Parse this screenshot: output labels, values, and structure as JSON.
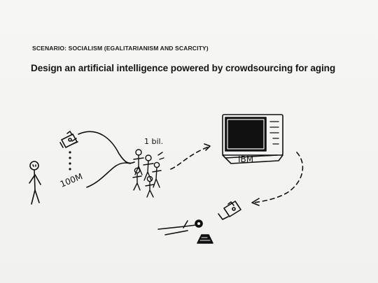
{
  "scenario": "SCENARIO: SOCIALISM (EGALITARIANISM AND SCARCITY)",
  "headline": "Design an artificial intelligence powered by crowdsourcing for aging",
  "sketch": {
    "crowd_label": "1 bil.",
    "elder_label": "100M",
    "computer_label": "IBM"
  }
}
